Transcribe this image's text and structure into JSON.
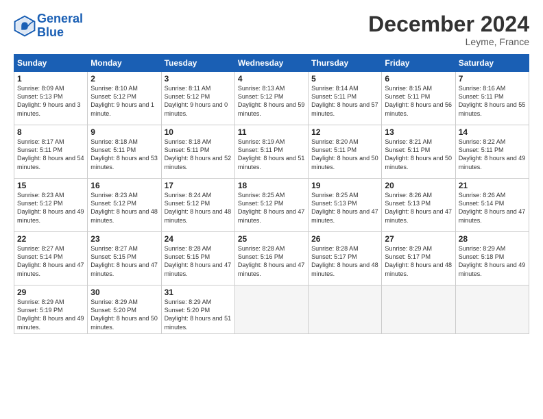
{
  "header": {
    "logo_line1": "General",
    "logo_line2": "Blue",
    "month_title": "December 2024",
    "location": "Leyme, France"
  },
  "weekdays": [
    "Sunday",
    "Monday",
    "Tuesday",
    "Wednesday",
    "Thursday",
    "Friday",
    "Saturday"
  ],
  "weeks": [
    [
      {
        "day": "1",
        "sunrise": "8:09 AM",
        "sunset": "5:13 PM",
        "daylight": "9 hours and 3 minutes."
      },
      {
        "day": "2",
        "sunrise": "8:10 AM",
        "sunset": "5:12 PM",
        "daylight": "9 hours and 1 minute."
      },
      {
        "day": "3",
        "sunrise": "8:11 AM",
        "sunset": "5:12 PM",
        "daylight": "9 hours and 0 minutes."
      },
      {
        "day": "4",
        "sunrise": "8:13 AM",
        "sunset": "5:12 PM",
        "daylight": "8 hours and 59 minutes."
      },
      {
        "day": "5",
        "sunrise": "8:14 AM",
        "sunset": "5:11 PM",
        "daylight": "8 hours and 57 minutes."
      },
      {
        "day": "6",
        "sunrise": "8:15 AM",
        "sunset": "5:11 PM",
        "daylight": "8 hours and 56 minutes."
      },
      {
        "day": "7",
        "sunrise": "8:16 AM",
        "sunset": "5:11 PM",
        "daylight": "8 hours and 55 minutes."
      }
    ],
    [
      {
        "day": "8",
        "sunrise": "8:17 AM",
        "sunset": "5:11 PM",
        "daylight": "8 hours and 54 minutes."
      },
      {
        "day": "9",
        "sunrise": "8:18 AM",
        "sunset": "5:11 PM",
        "daylight": "8 hours and 53 minutes."
      },
      {
        "day": "10",
        "sunrise": "8:18 AM",
        "sunset": "5:11 PM",
        "daylight": "8 hours and 52 minutes."
      },
      {
        "day": "11",
        "sunrise": "8:19 AM",
        "sunset": "5:11 PM",
        "daylight": "8 hours and 51 minutes."
      },
      {
        "day": "12",
        "sunrise": "8:20 AM",
        "sunset": "5:11 PM",
        "daylight": "8 hours and 50 minutes."
      },
      {
        "day": "13",
        "sunrise": "8:21 AM",
        "sunset": "5:11 PM",
        "daylight": "8 hours and 50 minutes."
      },
      {
        "day": "14",
        "sunrise": "8:22 AM",
        "sunset": "5:11 PM",
        "daylight": "8 hours and 49 minutes."
      }
    ],
    [
      {
        "day": "15",
        "sunrise": "8:23 AM",
        "sunset": "5:12 PM",
        "daylight": "8 hours and 49 minutes."
      },
      {
        "day": "16",
        "sunrise": "8:23 AM",
        "sunset": "5:12 PM",
        "daylight": "8 hours and 48 minutes."
      },
      {
        "day": "17",
        "sunrise": "8:24 AM",
        "sunset": "5:12 PM",
        "daylight": "8 hours and 48 minutes."
      },
      {
        "day": "18",
        "sunrise": "8:25 AM",
        "sunset": "5:12 PM",
        "daylight": "8 hours and 47 minutes."
      },
      {
        "day": "19",
        "sunrise": "8:25 AM",
        "sunset": "5:13 PM",
        "daylight": "8 hours and 47 minutes."
      },
      {
        "day": "20",
        "sunrise": "8:26 AM",
        "sunset": "5:13 PM",
        "daylight": "8 hours and 47 minutes."
      },
      {
        "day": "21",
        "sunrise": "8:26 AM",
        "sunset": "5:14 PM",
        "daylight": "8 hours and 47 minutes."
      }
    ],
    [
      {
        "day": "22",
        "sunrise": "8:27 AM",
        "sunset": "5:14 PM",
        "daylight": "8 hours and 47 minutes."
      },
      {
        "day": "23",
        "sunrise": "8:27 AM",
        "sunset": "5:15 PM",
        "daylight": "8 hours and 47 minutes."
      },
      {
        "day": "24",
        "sunrise": "8:28 AM",
        "sunset": "5:15 PM",
        "daylight": "8 hours and 47 minutes."
      },
      {
        "day": "25",
        "sunrise": "8:28 AM",
        "sunset": "5:16 PM",
        "daylight": "8 hours and 47 minutes."
      },
      {
        "day": "26",
        "sunrise": "8:28 AM",
        "sunset": "5:17 PM",
        "daylight": "8 hours and 48 minutes."
      },
      {
        "day": "27",
        "sunrise": "8:29 AM",
        "sunset": "5:17 PM",
        "daylight": "8 hours and 48 minutes."
      },
      {
        "day": "28",
        "sunrise": "8:29 AM",
        "sunset": "5:18 PM",
        "daylight": "8 hours and 49 minutes."
      }
    ],
    [
      {
        "day": "29",
        "sunrise": "8:29 AM",
        "sunset": "5:19 PM",
        "daylight": "8 hours and 49 minutes."
      },
      {
        "day": "30",
        "sunrise": "8:29 AM",
        "sunset": "5:20 PM",
        "daylight": "8 hours and 50 minutes."
      },
      {
        "day": "31",
        "sunrise": "8:29 AM",
        "sunset": "5:20 PM",
        "daylight": "8 hours and 51 minutes."
      },
      null,
      null,
      null,
      null
    ]
  ]
}
